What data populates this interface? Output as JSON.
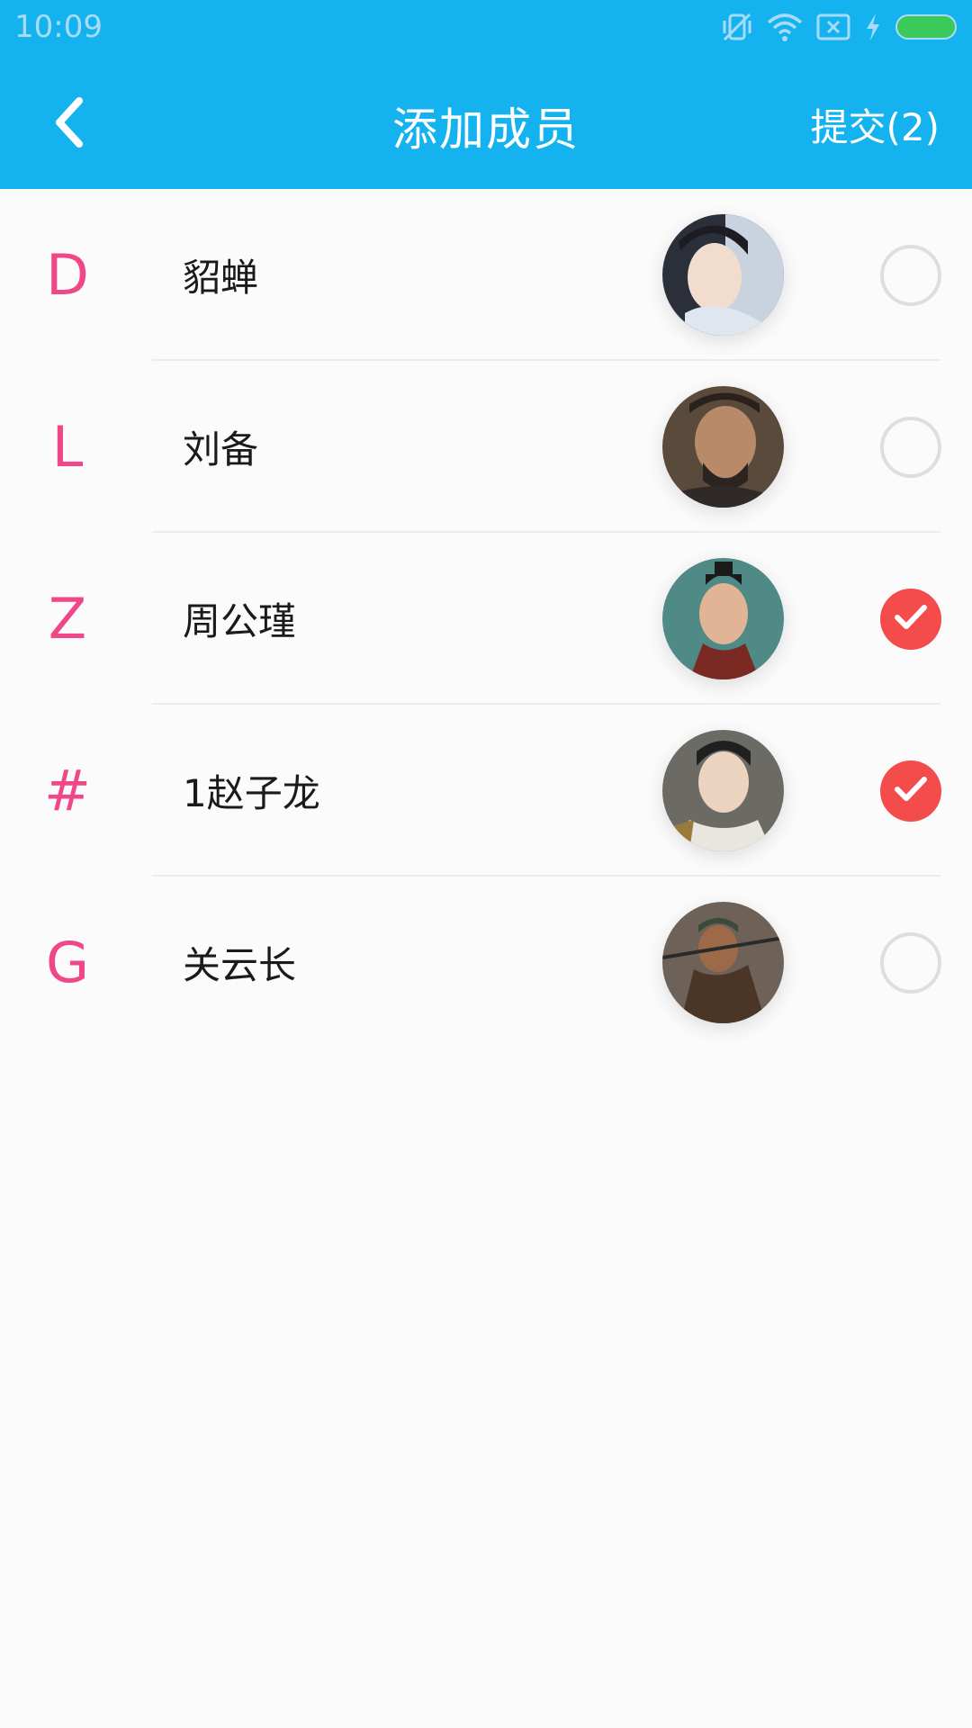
{
  "status_bar": {
    "time": "10:09",
    "icons": [
      "mute-vibrate-icon",
      "wifi-icon",
      "no-sim-icon",
      "charging-icon",
      "battery-icon"
    ],
    "battery_color": "#3cc95b"
  },
  "app_bar": {
    "title": "添加成员",
    "back_icon": "chevron-left-icon",
    "submit_label": "提交(2)",
    "background": "#15b2f0"
  },
  "members": [
    {
      "letter": "D",
      "name": "貂蝉",
      "selected": false
    },
    {
      "letter": "L",
      "name": "刘备",
      "selected": false
    },
    {
      "letter": "Z",
      "name": "周公瑾",
      "selected": true
    },
    {
      "letter": "#",
      "name": "1赵子龙",
      "selected": true
    },
    {
      "letter": "G",
      "name": "关云长",
      "selected": false
    }
  ],
  "colors": {
    "letter": "#f0478a",
    "checked": "#f44b4b",
    "unchecked_border": "#dedede"
  }
}
